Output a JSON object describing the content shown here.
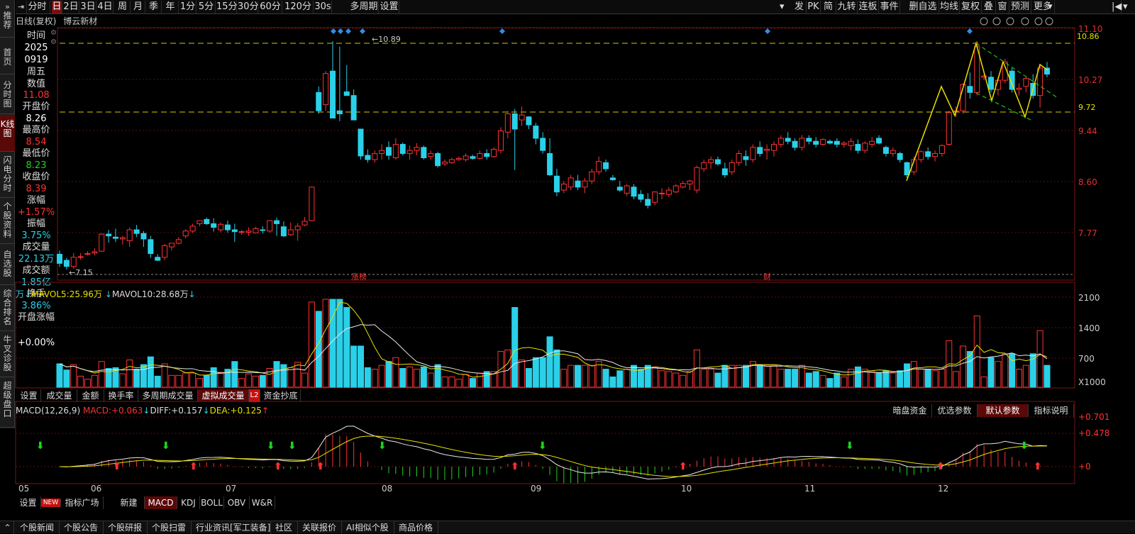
{
  "toolbar": {
    "left_items": [
      {
        "label": "分时"
      },
      {
        "label": "日",
        "active": true
      },
      {
        "label": "2日"
      },
      {
        "label": "3日"
      },
      {
        "label": "4日"
      },
      {
        "label": "周"
      },
      {
        "label": "月"
      },
      {
        "label": "季"
      },
      {
        "label": "年"
      },
      {
        "label": "1分"
      },
      {
        "label": "5分"
      },
      {
        "label": "15分"
      },
      {
        "label": "30分"
      },
      {
        "label": "60分"
      },
      {
        "label": "120分"
      },
      {
        "label": "30s"
      },
      {
        "label": "多周期"
      },
      {
        "label": "设置"
      }
    ],
    "right_items": [
      {
        "label": "发"
      },
      {
        "label": "PK"
      },
      {
        "label": "简"
      },
      {
        "label": "九转"
      },
      {
        "label": "连板"
      },
      {
        "label": "事件"
      },
      {
        "label": "删自选"
      },
      {
        "label": "均线"
      },
      {
        "label": "复权"
      },
      {
        "label": "叠"
      },
      {
        "label": "窗"
      },
      {
        "label": "预测"
      },
      {
        "label": "更多"
      }
    ]
  },
  "sidebar": {
    "items": [
      {
        "label": "推荐"
      },
      {
        "label": "首页"
      },
      {
        "label": "分时图"
      },
      {
        "label": "K线图",
        "active": true
      },
      {
        "label": "闪电分时"
      },
      {
        "label": "个股资料"
      },
      {
        "label": "自选股"
      },
      {
        "label": "综合排名"
      },
      {
        "label": "牛叉诊股"
      },
      {
        "label": "超级盘口"
      }
    ]
  },
  "chart_header": {
    "mode": "日线(复权)",
    "stock_name": "博云新材"
  },
  "info": {
    "time_label": "时间",
    "year": "2025",
    "date": "0919",
    "weekday": "周五",
    "value_label": "数值",
    "value": "11.08",
    "open_label": "开盘价",
    "open": "8.26",
    "high_label": "最高价",
    "high": "8.54",
    "low_label": "最低价",
    "low": "8.23",
    "close_label": "收盘价",
    "close": "8.39",
    "change_label": "涨幅",
    "change": "+1.57%",
    "amplitude_label": "振幅",
    "amplitude": "3.75%",
    "volume_label": "成交量",
    "volume": "22.13万",
    "amount_label": "成交额",
    "amount": "1.85亿",
    "turnover_label": "换手",
    "turnover": "3.86%",
    "open_change_label": "开盘涨幅",
    "open_change": "+0.00%"
  },
  "price_axis": {
    "ticks": [
      "11.10",
      "10.27",
      "9.44",
      "8.60",
      "7.77"
    ]
  },
  "price_lines": {
    "upper": "10.86",
    "lower": "9.72",
    "high_marker": "10.89",
    "low_marker": "7.15"
  },
  "event_markers": {
    "limit_list": "涨榜",
    "finance": "财"
  },
  "volume_legend": {
    "unit": "万",
    "mavol5_label": "MAVOL5:",
    "mavol5": "25.96万",
    "mavol10_label": "MAVOL10:",
    "mavol10": "28.68万"
  },
  "volume_axis": {
    "ticks": [
      "2100",
      "1400",
      "700"
    ],
    "unit": "X1000"
  },
  "volume_tabs": [
    {
      "label": "设置"
    },
    {
      "label": "成交量"
    },
    {
      "label": "金额"
    },
    {
      "label": "换手率"
    },
    {
      "label": "多周期成交量"
    },
    {
      "label": "虚拟成交量",
      "active": true
    },
    {
      "label": "L2"
    },
    {
      "label": "资金抄底"
    }
  ],
  "macd_legend": {
    "name": "MACD(12,26,9)",
    "macd_label": "MACD:",
    "macd": "+0.063",
    "diff_label": "DIFF:",
    "diff": "+0.157",
    "dea_label": "DEA:",
    "dea": "+0.125"
  },
  "macd_tabs": [
    {
      "label": "暗盘资金"
    },
    {
      "label": "优选参数"
    },
    {
      "label": "默认参数",
      "active": true
    },
    {
      "label": "指标说明"
    }
  ],
  "macd_axis": {
    "ticks": [
      "+0.701",
      "+0.478",
      "+0"
    ]
  },
  "months": [
    "05",
    "06",
    "07",
    "08",
    "09",
    "10",
    "11",
    "12"
  ],
  "indicator_tabs": [
    {
      "label": "设置"
    },
    {
      "label": "NEW"
    },
    {
      "label": "指标广场"
    },
    {
      "label": "新建"
    },
    {
      "label": "MACD",
      "active": true
    },
    {
      "label": "KDJ"
    },
    {
      "label": "BOLL"
    },
    {
      "label": "OBV"
    },
    {
      "label": "W&R"
    }
  ],
  "bottom_links": [
    {
      "label": "个股新闻"
    },
    {
      "label": "个股公告"
    },
    {
      "label": "个股研报"
    },
    {
      "label": "个股扫雷"
    },
    {
      "label": "行业资讯[军工装备]"
    },
    {
      "label": "社区"
    },
    {
      "label": "关联报价"
    },
    {
      "label": "AI相似个股"
    },
    {
      "label": "商品价格"
    }
  ],
  "colors": {
    "up": "#ff3232",
    "down": "#2ad0e8",
    "ma5": "#e8e000",
    "ma10": "#e8e8e8",
    "dash": "#d8c800",
    "active_tab": "#7a0f0f"
  },
  "chart_data": {
    "type": "candlestick",
    "title": "博云新材 日线(复权)",
    "y_range": [
      7.15,
      10.89
    ],
    "ohlc": [
      [
        7.4,
        7.46,
        7.19,
        7.25
      ],
      [
        7.3,
        7.34,
        7.15,
        7.2
      ],
      [
        7.2,
        7.42,
        7.16,
        7.35
      ],
      [
        7.35,
        7.42,
        7.31,
        7.36
      ],
      [
        7.4,
        7.45,
        7.38,
        7.41
      ],
      [
        7.42,
        7.5,
        7.38,
        7.44
      ],
      [
        7.45,
        7.74,
        7.44,
        7.73
      ],
      [
        7.73,
        7.8,
        7.59,
        7.7
      ],
      [
        7.68,
        7.82,
        7.6,
        7.66
      ],
      [
        7.65,
        7.7,
        7.56,
        7.67
      ],
      [
        7.62,
        7.84,
        7.52,
        7.8
      ],
      [
        7.8,
        7.88,
        7.68,
        7.74
      ],
      [
        7.74,
        7.78,
        7.52,
        7.65
      ],
      [
        7.64,
        7.7,
        7.34,
        7.41
      ],
      [
        7.35,
        7.4,
        7.29,
        7.3
      ],
      [
        7.35,
        7.57,
        7.3,
        7.54
      ],
      [
        7.52,
        7.58,
        7.46,
        7.58
      ],
      [
        7.58,
        7.68,
        7.56,
        7.64
      ],
      [
        7.7,
        7.81,
        7.66,
        7.78
      ],
      [
        7.78,
        7.9,
        7.75,
        7.86
      ],
      [
        7.9,
        7.94,
        7.86,
        7.95
      ],
      [
        7.97,
        8.0,
        7.88,
        7.9
      ],
      [
        7.9,
        7.99,
        7.77,
        7.84
      ],
      [
        7.8,
        7.92,
        7.76,
        7.89
      ],
      [
        7.88,
        7.95,
        7.75,
        7.8
      ],
      [
        7.8,
        7.9,
        7.6,
        7.77
      ],
      [
        7.76,
        7.8,
        7.72,
        7.77
      ],
      [
        7.76,
        7.84,
        7.7,
        7.78
      ],
      [
        7.75,
        7.85,
        7.74,
        7.82
      ],
      [
        7.8,
        7.86,
        7.74,
        7.79
      ],
      [
        7.78,
        7.96,
        7.75,
        7.95
      ],
      [
        7.95,
        8.0,
        7.7,
        7.9
      ],
      [
        7.85,
        7.94,
        7.68,
        7.7
      ],
      [
        7.72,
        7.92,
        7.7,
        7.8
      ],
      [
        7.8,
        7.91,
        7.62,
        7.86
      ],
      [
        7.88,
        8.01,
        7.86,
        7.94
      ],
      [
        7.95,
        8.51,
        7.94,
        8.5
      ],
      [
        10.05,
        10.15,
        9.7,
        9.75
      ],
      [
        9.85,
        10.4,
        9.75,
        10.36
      ],
      [
        10.4,
        10.89,
        9.73,
        9.63
      ],
      [
        9.75,
        10.8,
        9.58,
        9.7
      ],
      [
        10.06,
        10.5,
        10.0,
        10.0
      ],
      [
        10.0,
        10.1,
        9.6,
        9.6
      ],
      [
        9.45,
        9.45,
        8.95,
        9.01
      ],
      [
        9.02,
        9.12,
        8.9,
        8.95
      ],
      [
        8.95,
        9.1,
        8.9,
        9.05
      ],
      [
        9.05,
        9.2,
        8.95,
        9.1
      ],
      [
        9.15,
        9.25,
        8.95,
        9.02
      ],
      [
        8.98,
        9.3,
        8.95,
        9.2
      ],
      [
        9.2,
        9.23,
        9.02,
        9.05
      ],
      [
        9.05,
        9.18,
        8.95,
        9.1
      ],
      [
        9.1,
        9.22,
        9.02,
        9.15
      ],
      [
        9.15,
        9.18,
        8.95,
        8.98
      ],
      [
        9.0,
        9.1,
        8.95,
        9.05
      ],
      [
        9.05,
        9.08,
        8.82,
        8.85
      ],
      [
        8.88,
        8.95,
        8.85,
        8.91
      ],
      [
        8.9,
        8.98,
        8.88,
        8.95
      ],
      [
        8.95,
        9.0,
        8.93,
        8.97
      ],
      [
        8.95,
        9.05,
        8.92,
        9.01
      ],
      [
        9.0,
        9.03,
        8.95,
        8.97
      ],
      [
        8.97,
        9.1,
        8.95,
        9.05
      ],
      [
        9.05,
        9.12,
        8.95,
        9.0
      ],
      [
        9.0,
        9.15,
        8.98,
        9.12
      ],
      [
        9.1,
        9.48,
        9.05,
        9.42
      ],
      [
        9.4,
        9.75,
        9.3,
        9.7
      ],
      [
        9.7,
        9.78,
        8.78,
        9.45
      ],
      [
        9.6,
        9.82,
        9.5,
        9.68
      ],
      [
        9.65,
        9.66,
        9.45,
        9.52
      ],
      [
        9.5,
        9.55,
        9.2,
        9.3
      ],
      [
        9.3,
        9.4,
        9.05,
        9.1
      ],
      [
        9.05,
        9.3,
        8.68,
        8.7
      ],
      [
        8.68,
        8.8,
        8.35,
        8.42
      ],
      [
        8.45,
        8.6,
        8.4,
        8.55
      ],
      [
        8.5,
        8.7,
        8.45,
        8.65
      ],
      [
        8.6,
        8.7,
        8.45,
        8.5
      ],
      [
        8.5,
        8.65,
        8.4,
        8.6
      ],
      [
        8.6,
        8.8,
        8.55,
        8.75
      ],
      [
        8.75,
        9.0,
        8.7,
        8.92
      ],
      [
        8.9,
        8.95,
        8.75,
        8.8
      ],
      [
        8.65,
        8.7,
        8.6,
        8.62
      ],
      [
        8.5,
        8.6,
        8.42,
        8.45
      ],
      [
        8.4,
        8.55,
        8.35,
        8.52
      ],
      [
        8.5,
        8.55,
        8.3,
        8.35
      ],
      [
        8.38,
        8.45,
        8.25,
        8.3
      ],
      [
        8.3,
        8.4,
        8.15,
        8.2
      ],
      [
        8.25,
        8.43,
        8.2,
        8.42
      ],
      [
        8.4,
        8.48,
        8.3,
        8.4
      ],
      [
        8.38,
        8.5,
        8.33,
        8.45
      ],
      [
        8.42,
        8.55,
        8.4,
        8.52
      ],
      [
        8.5,
        8.6,
        8.48,
        8.56
      ],
      [
        8.55,
        8.62,
        8.45,
        8.6
      ],
      [
        8.45,
        8.85,
        8.4,
        8.82
      ],
      [
        8.8,
        8.95,
        8.75,
        8.9
      ],
      [
        8.9,
        9.0,
        8.8,
        8.95
      ],
      [
        8.95,
        9.0,
        8.85,
        8.88
      ],
      [
        8.8,
        8.9,
        8.65,
        8.7
      ],
      [
        8.75,
        8.95,
        8.7,
        8.9
      ],
      [
        8.9,
        9.1,
        8.85,
        9.05
      ],
      [
        9.0,
        9.1,
        8.85,
        8.95
      ],
      [
        8.95,
        9.2,
        8.9,
        9.15
      ],
      [
        9.15,
        9.25,
        9.0,
        9.05
      ],
      [
        9.1,
        9.2,
        8.95,
        9.12
      ],
      [
        9.1,
        9.25,
        9.0,
        9.2
      ],
      [
        9.2,
        9.35,
        9.15,
        9.3
      ],
      [
        9.3,
        9.4,
        9.2,
        9.25
      ],
      [
        9.25,
        9.3,
        9.1,
        9.15
      ],
      [
        9.15,
        9.35,
        9.1,
        9.3
      ],
      [
        9.3,
        9.35,
        9.2,
        9.25
      ],
      [
        9.25,
        9.32,
        9.15,
        9.2
      ],
      [
        9.2,
        9.3,
        9.18,
        9.28
      ],
      [
        9.25,
        9.28,
        9.2,
        9.22
      ],
      [
        9.25,
        9.3,
        9.15,
        9.2
      ],
      [
        9.2,
        9.25,
        9.15,
        9.22
      ],
      [
        9.18,
        9.3,
        9.1,
        9.25
      ],
      [
        9.2,
        9.28,
        9.05,
        9.1
      ],
      [
        9.1,
        9.25,
        9.05,
        9.22
      ],
      [
        9.2,
        9.32,
        9.15,
        9.25
      ],
      [
        9.3,
        9.35,
        9.2,
        9.22
      ],
      [
        9.15,
        9.18,
        9.0,
        9.05
      ],
      [
        9.05,
        9.15,
        9.0,
        9.1
      ],
      [
        9.05,
        9.08,
        8.9,
        8.95
      ],
      [
        8.9,
        8.92,
        8.65,
        8.7
      ],
      [
        8.75,
        9.0,
        8.7,
        8.95
      ],
      [
        8.95,
        9.1,
        8.9,
        9.08
      ],
      [
        9.08,
        9.15,
        8.95,
        9.0
      ],
      [
        9.0,
        9.1,
        8.92,
        9.05
      ],
      [
        9.05,
        9.2,
        9.0,
        9.18
      ],
      [
        9.2,
        9.75,
        9.18,
        9.72
      ],
      [
        9.75,
        9.82,
        9.65,
        9.75
      ],
      [
        9.75,
        10.2,
        9.7,
        10.18
      ],
      [
        10.15,
        10.38,
        9.95,
        10.05
      ],
      [
        10.05,
        10.89,
        10.0,
        10.8
      ],
      [
        10.3,
        10.35,
        10.25,
        10.32
      ],
      [
        10.3,
        10.4,
        10.05,
        10.1
      ],
      [
        10.1,
        10.3,
        10.0,
        10.25
      ],
      [
        10.25,
        10.6,
        10.2,
        10.55
      ],
      [
        10.4,
        10.45,
        10.05,
        10.1
      ],
      [
        10.1,
        10.2,
        10.0,
        10.12
      ],
      [
        10.15,
        10.3,
        10.05,
        10.28
      ],
      [
        10.2,
        10.35,
        9.95,
        10.0
      ],
      [
        10.0,
        10.5,
        9.8,
        10.45
      ],
      [
        10.45,
        10.55,
        10.3,
        10.35
      ]
    ],
    "volume_range": [
      0,
      2100
    ],
    "mavol5": "25.96万",
    "mavol10": "28.68万"
  }
}
